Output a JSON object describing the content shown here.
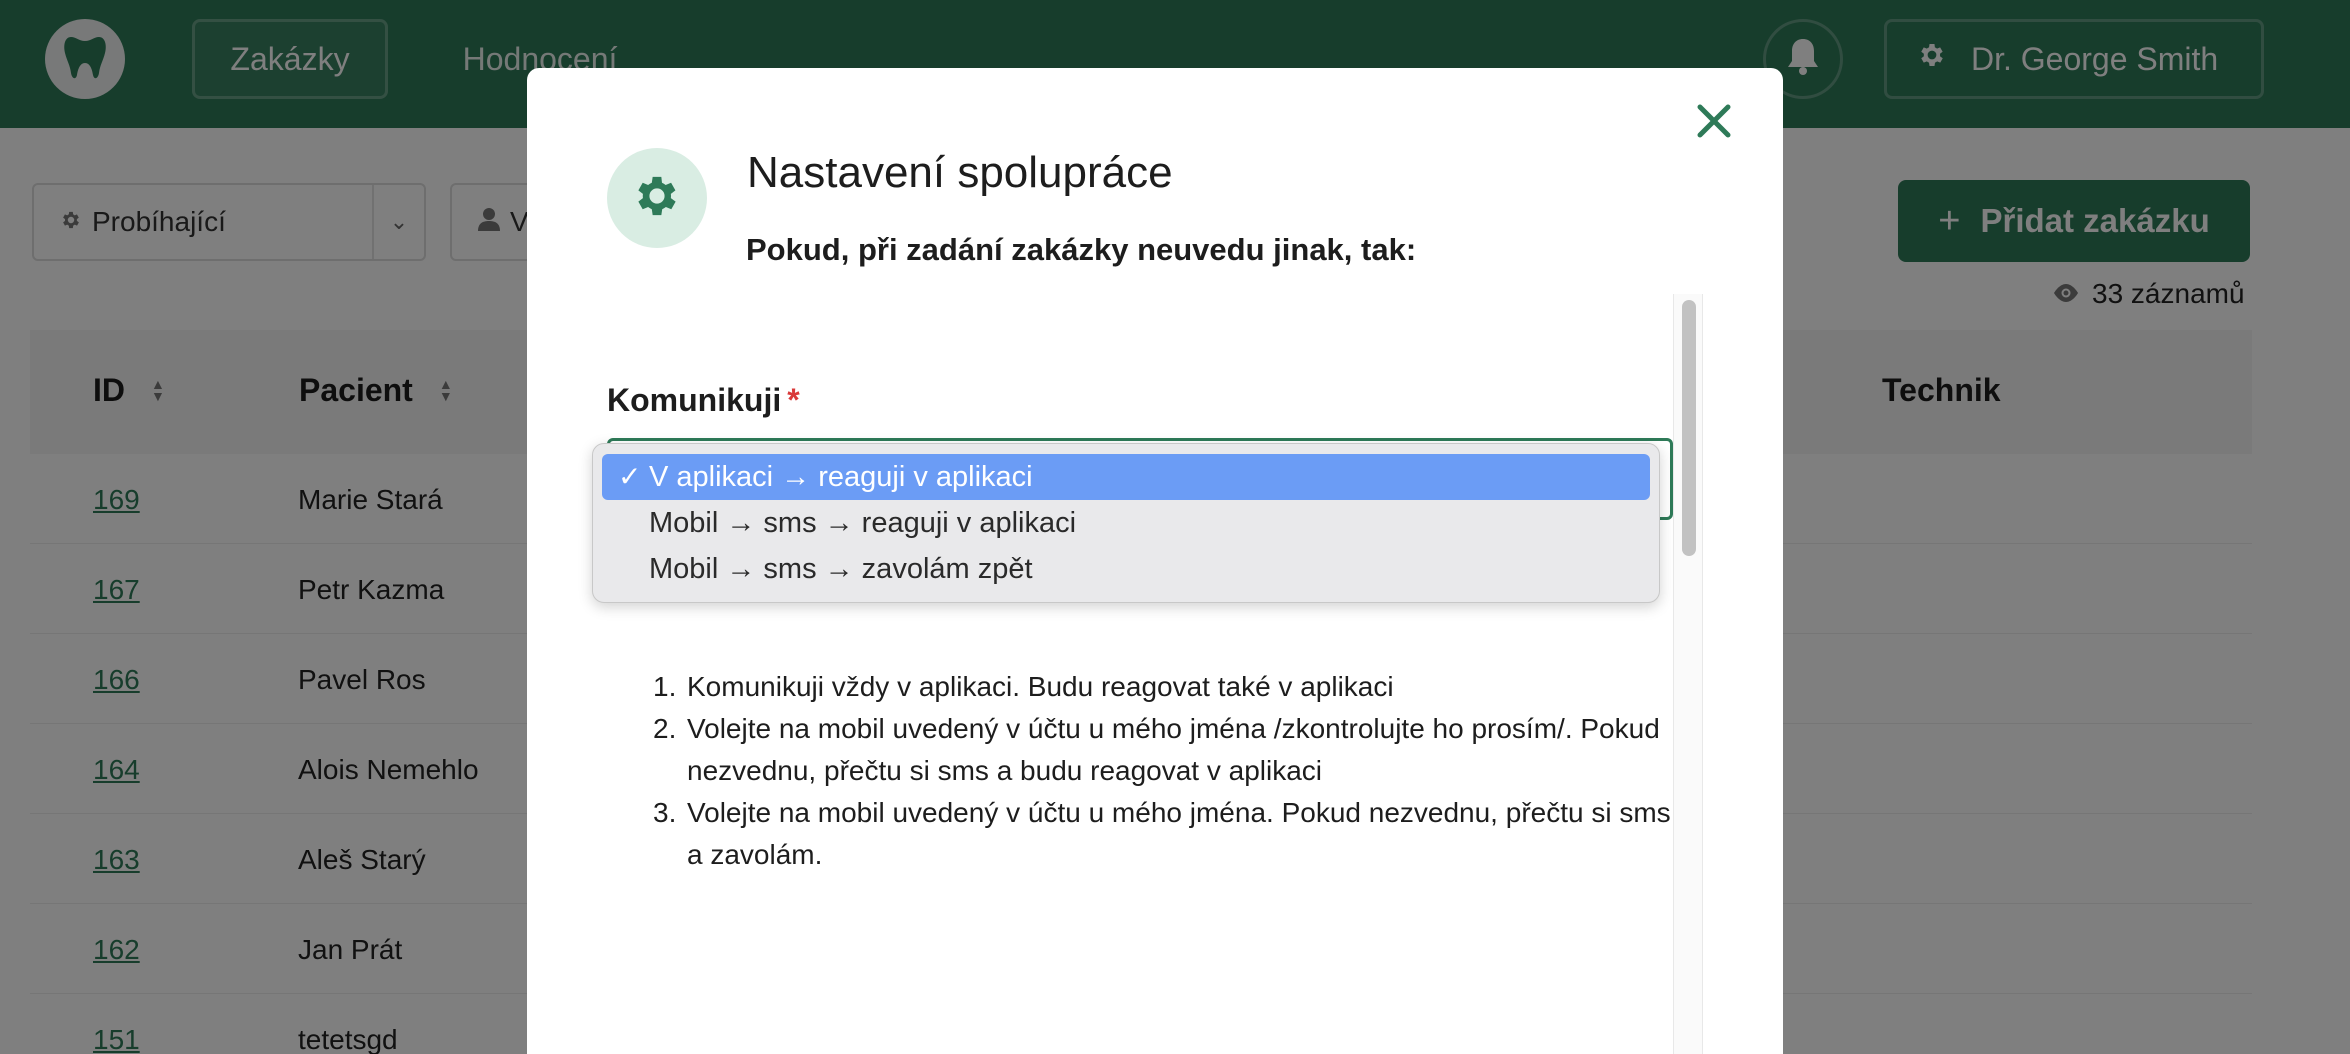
{
  "nav": {
    "logo_icon": "tooth-icon",
    "zakazky_label": "Zakázky",
    "hodnoceni_label": "Hodnocení",
    "bell_icon": "bell-icon",
    "user_icon": "gear-icon",
    "user_name": "Dr. George Smith"
  },
  "filters": {
    "status_value": "Probíhající",
    "person_value": "V"
  },
  "toolbar": {
    "add_label": "Přidat zakázku",
    "records_label": "33 záznamů"
  },
  "table": {
    "headers": {
      "id": "ID",
      "pacient": "Pacient",
      "technik": "Technik"
    },
    "rows": [
      {
        "id": "169",
        "name": "Marie Stará"
      },
      {
        "id": "167",
        "name": "Petr Kazma"
      },
      {
        "id": "166",
        "name": "Pavel Ros"
      },
      {
        "id": "164",
        "name": "Alois Nemehlo"
      },
      {
        "id": "163",
        "name": "Aleš Starý"
      },
      {
        "id": "162",
        "name": "Jan Prát"
      },
      {
        "id": "151",
        "name": "tetetsgd"
      }
    ]
  },
  "modal": {
    "title": "Nastavení spolupráce",
    "subtitle": "Pokud, při zadání zakázky neuvedu jinak, tak:",
    "field_label": "Komunikuji",
    "required_mark": "*",
    "options": [
      "V aplikaci → reaguji v aplikaci",
      "Mobil → sms → reaguji v aplikaci",
      "Mobil → sms → zavolám zpět"
    ],
    "selected_index": 0,
    "check_mark": "✓",
    "descriptions": [
      {
        "num": "1.",
        "text": "Komunikuji vždy v aplikaci. Budu reagovat také v aplikaci"
      },
      {
        "num": "2.",
        "text": "Volejte na mobil uvedený v účtu u mého jména /zkontrolujte ho prosím/. Pokud nezvednu, přečtu si sms a budu reagovat v aplikaci"
      },
      {
        "num": "3.",
        "text": "Volejte na mobil uvedený v účtu u mého jména. Pokud nezvednu, přečtu si sms a zavolám."
      }
    ]
  },
  "colors": {
    "brand": "#2e7a58",
    "selected_option": "#6b9cf5",
    "required": "#d93a3a"
  }
}
